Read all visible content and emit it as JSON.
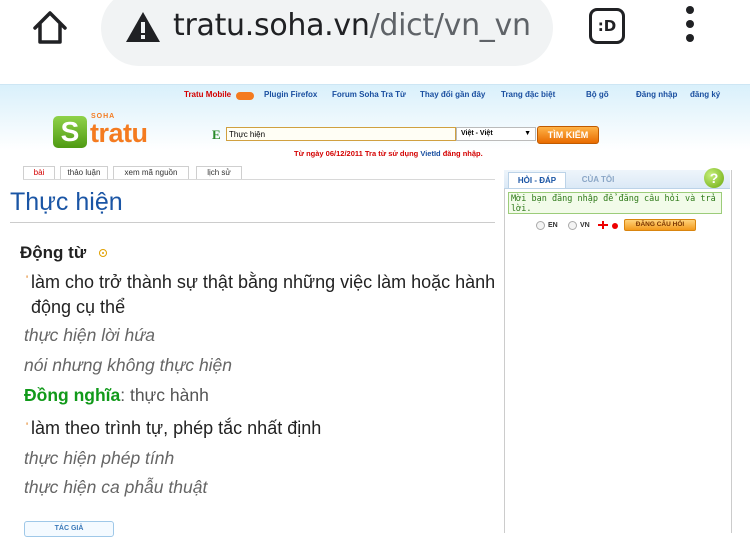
{
  "browser": {
    "url_domain": "tratu.soha.vn",
    "url_path": "/dict/vn_vn",
    "tab_switcher_label": ":D",
    "icons": [
      "home-icon",
      "warning-icon",
      "tab-switcher-icon",
      "overflow-menu-icon"
    ]
  },
  "header": {
    "links": {
      "tratu_mobile": "Tratu Mobile",
      "plugin_firefox": "Plugin Firefox",
      "forum": "Forum Soha Tra Từ",
      "recent_changes": "Thay đổi gần đây",
      "special_page": "Trang đặc biệt",
      "typing_tool": "Bộ gõ",
      "login": "Đăng nhập",
      "register": "đăng ký"
    },
    "logo": {
      "letter": "S",
      "brand": "SOHA",
      "word": "tratu"
    },
    "search": {
      "value": "Thực hiện",
      "dictionary": "Việt - Việt",
      "button": "TÌM KIẾM"
    },
    "notice": {
      "prefix": "Từ ngày 06/12/2011 Tra từ sử dụng ",
      "brand": "VietId",
      "suffix": " đăng nhập."
    }
  },
  "tabs": {
    "article": "bài",
    "discussion": "thảo luận",
    "source": "xem mã nguồn",
    "history": "lịch sử"
  },
  "entry": {
    "title": "Thực hiện",
    "pos": "Động từ",
    "definitions": [
      {
        "text": "làm cho trở thành sự thật bằng những việc làm hoặc hành động cụ thể",
        "examples": [
          "thực hiện lời hứa",
          "nói nhưng không thực hiện"
        ],
        "synonym_label": "Đồng nghĩa",
        "synonym_value": ": thực hành"
      },
      {
        "text": "làm theo trình tự, phép tắc nhất định",
        "examples": [
          "thực hiện phép tính",
          "thực hiện ca phẫu thuật"
        ]
      }
    ],
    "author_tab": "TÁC GIẢ"
  },
  "sidebar": {
    "tab_qa": "HỎI - ĐÁP",
    "tab_mine": "CỦA TÔI",
    "help": "?",
    "message": "Mời bạn đăng nhập để đăng câu hỏi và trả lời.",
    "lang_en": "EN",
    "lang_vn": "VN",
    "ask_button": "ĐĂNG CÂU HỎI"
  },
  "colors": {
    "link_blue": "#1a4fa0",
    "title_blue": "#1a55a5",
    "orange": "#f47b20",
    "synonym_green": "#119a1a",
    "red": "#d40000"
  }
}
